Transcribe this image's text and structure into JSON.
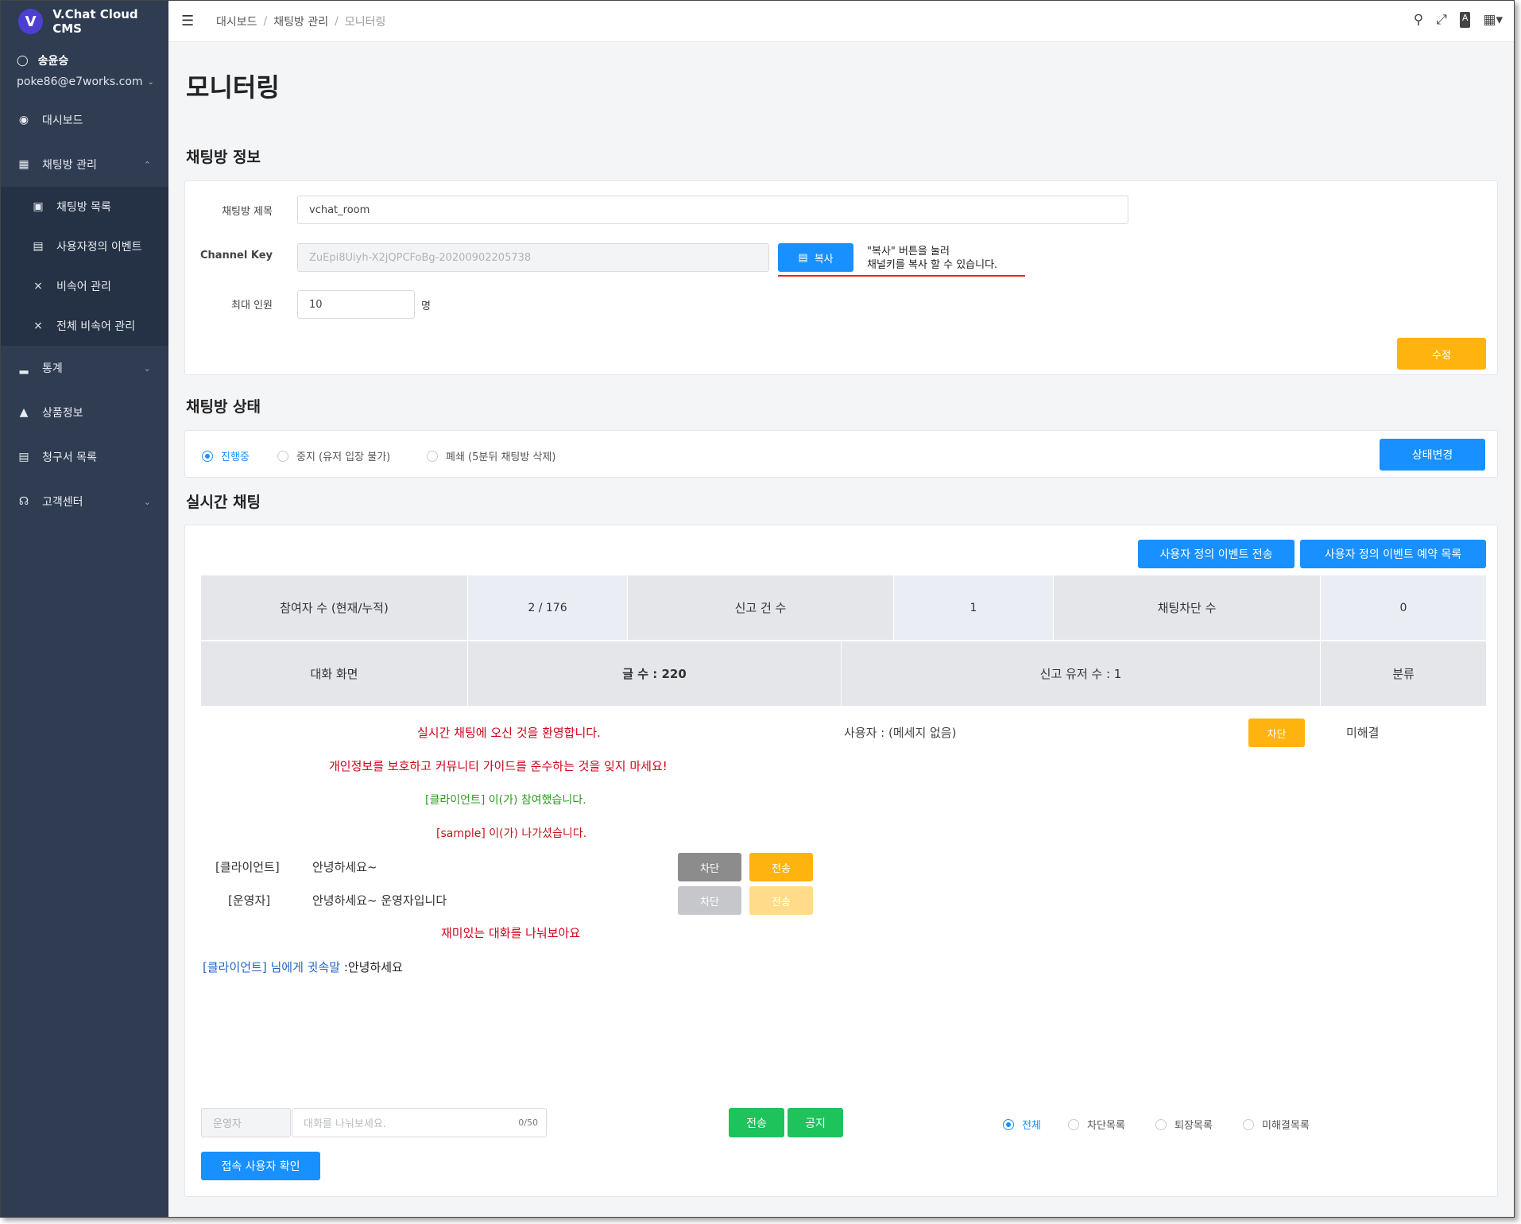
{
  "app": {
    "brand": "V.Chat Cloud CMS",
    "logo_letter": "V"
  },
  "user": {
    "name": "송윤승",
    "email": "poke86@e7works.com"
  },
  "sidebar": {
    "items": [
      {
        "label": "대시보드",
        "icon": "dashboard-icon"
      },
      {
        "label": "채팅방 관리",
        "icon": "grid-icon",
        "expanded": true,
        "children": [
          {
            "label": "채팅방 목록",
            "icon": "chat-list-icon"
          },
          {
            "label": "사용자정의 이벤트",
            "icon": "event-icon"
          },
          {
            "label": "비속어 관리",
            "icon": "mic-off-icon"
          },
          {
            "label": "전체 비속어 관리",
            "icon": "mic-off-icon"
          }
        ]
      },
      {
        "label": "통계",
        "icon": "bar-chart-icon"
      },
      {
        "label": "상품정보",
        "icon": "shopping-bag-icon"
      },
      {
        "label": "청구서 목록",
        "icon": "invoice-icon"
      },
      {
        "label": "고객센터",
        "icon": "headset-icon"
      }
    ]
  },
  "breadcrumb": [
    "대시보드",
    "채팅방 관리",
    "모니터링"
  ],
  "page_title": "모니터링",
  "room_info": {
    "section_title": "채팅방 정보",
    "title_label": "채팅방 제목",
    "title_value": "vchat_room",
    "channel_key_label": "Channel Key",
    "channel_key_value": "ZuEpi8Uiyh-X2jQPCFoBg-20200902205738",
    "copy_button": "복사",
    "copy_hint_line1": "\"복사\" 버튼을 눌러",
    "copy_hint_line2": "채널키를 복사 할 수 있습니다.",
    "max_label": "최대 인원",
    "max_value": "10",
    "max_unit": "명",
    "edit_button": "수정"
  },
  "room_status": {
    "section_title": "채팅방 상태",
    "options": [
      "진행중",
      "중지 (유저 입장 불가)",
      "폐쇄 (5분뒤 채팅방 삭제)"
    ],
    "selected": 0,
    "change_button": "상태변경"
  },
  "live_chat": {
    "section_title": "실시간 채팅",
    "event_send_button": "사용자 정의 이벤트 전송",
    "event_reserve_button": "사용자 정의 이벤트 예약 목록",
    "stats": {
      "participants_label": "참여자 수 (현재/누적)",
      "participants_value": "2 / 176",
      "reports_label": "신고 건 수",
      "reports_value": "1",
      "blocked_label": "채팅차단 수",
      "blocked_value": "0"
    },
    "headers": {
      "chat_screen": "대화 화면",
      "post_count": "글 수 : 220",
      "reported_users": "신고 유저 수 : 1",
      "category": "분류"
    },
    "messages": {
      "welcome": "실시간 채팅에 오신 것을 환영합니다.",
      "guide": "개인정보를 보호하고 커뮤니티 가이드를 준수하는 것을 잊지 마세요!",
      "join": "[클라이언트] 이(가) 참여했습니다.",
      "leave": "[sample] 이(가) 나가셨습니다.",
      "chat1_user": "[클라이언트]",
      "chat1_text": "안녕하세요~",
      "chat2_user": "[운영자]",
      "chat2_text": "안녕하세요~ 운영자입니다",
      "fun": "재미있는 대화를 나눠보아요",
      "whisper_target": "[클라이언트] 님에게 귓속말",
      "whisper_text": " :안녕하세요"
    },
    "block_button": "차단",
    "send_button": "전송",
    "report": {
      "user_text": "사용자 : (메세지 없음)",
      "block_button": "차단",
      "status": "미해결"
    },
    "composer": {
      "sender": "운영자",
      "placeholder": "대화를 나눠보세요.",
      "counter": "0/50",
      "send_button": "전송",
      "notice_button": "공지"
    },
    "filters": [
      "전체",
      "차단목록",
      "퇴장목록",
      "미해결목록"
    ],
    "filter_selected": 0,
    "connected_users_button": "접속 사용자 확인"
  },
  "colors": {
    "sidebar": "#2f3c52",
    "primary": "#1890ff",
    "warning": "#ffb30f",
    "success": "#1ec35c"
  }
}
